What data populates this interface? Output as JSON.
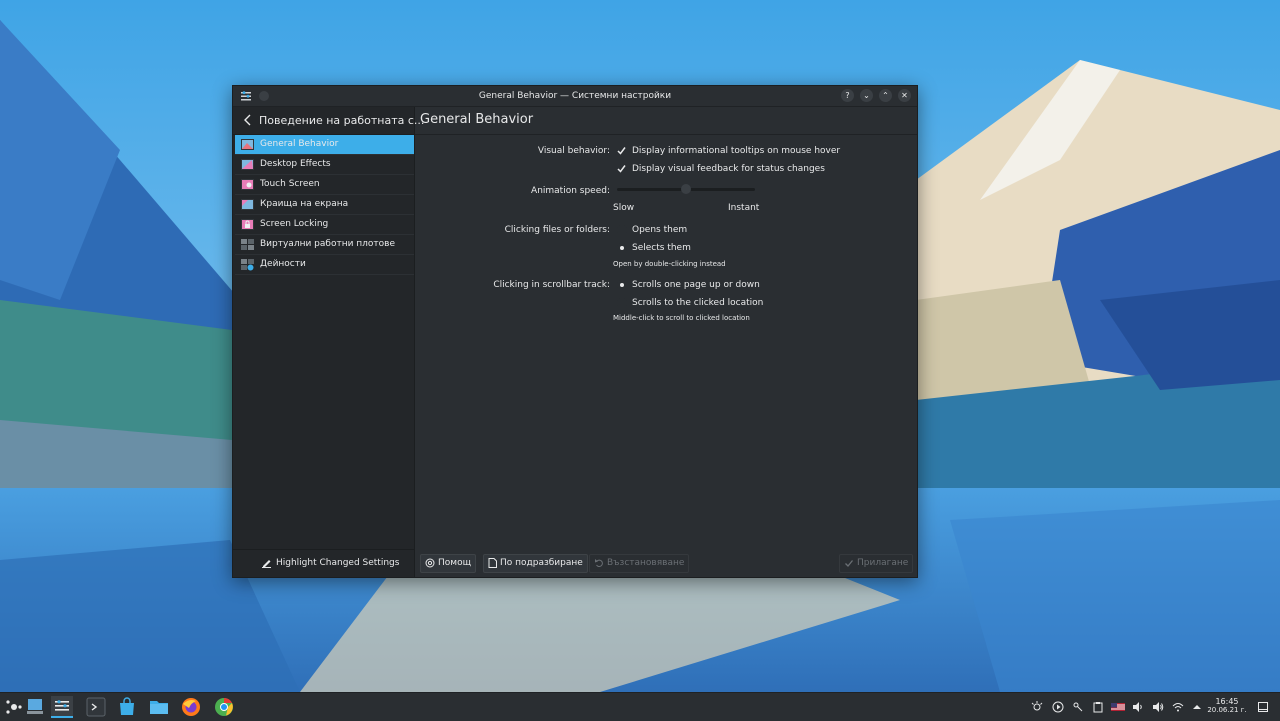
{
  "colors": {
    "accent": "#3daee9",
    "window_bg": "#2a2e32",
    "sidebar_bg": "#232629"
  },
  "window": {
    "title": "General Behavior — Системни настройки",
    "buttons": [
      "?",
      "⌄",
      "⌃",
      "✕"
    ]
  },
  "sidebar": {
    "back_icon": "arrow-left-icon",
    "title": "Поведение на работната с...",
    "items": [
      {
        "label": "General Behavior",
        "icon": "general-behavior-icon",
        "active": true
      },
      {
        "label": "Desktop Effects",
        "icon": "desktop-effects-icon"
      },
      {
        "label": "Touch Screen",
        "icon": "touch-screen-icon"
      },
      {
        "label": "Краища на екрана",
        "icon": "screen-edges-icon"
      },
      {
        "label": "Screen Locking",
        "icon": "screen-locking-icon"
      },
      {
        "label": "Виртуални работни плотове",
        "icon": "virtual-desktops-icon"
      },
      {
        "label": "Дейности",
        "icon": "activities-icon"
      }
    ],
    "footer_button": "Highlight Changed Settings"
  },
  "content": {
    "title": "General Behavior",
    "visual_behavior": {
      "label": "Visual behavior:",
      "options": [
        {
          "label": "Display informational tooltips on mouse hover",
          "checked": true
        },
        {
          "label": "Display visual feedback for status changes",
          "checked": true
        }
      ]
    },
    "animation_speed": {
      "label": "Animation speed:",
      "min_label": "Slow",
      "max_label": "Instant",
      "value_fraction": 0.5
    },
    "clicking_files": {
      "label": "Clicking files or folders:",
      "options": [
        {
          "label": "Opens them",
          "selected": false
        },
        {
          "label": "Selects them",
          "selected": true
        }
      ],
      "hint": "Open by double-clicking instead"
    },
    "scrollbar": {
      "label": "Clicking in scrollbar track:",
      "options": [
        {
          "label": "Scrolls one page up or down",
          "selected": true
        },
        {
          "label": "Scrolls to the clicked location",
          "selected": false
        }
      ],
      "hint": "Middle-click to scroll to clicked location"
    }
  },
  "buttons": {
    "help": "Помощ",
    "defaults": "По подразбиране",
    "reset": "Възстановяване",
    "apply": "Прилагане"
  },
  "taskbar": {
    "clock_time": "16:45",
    "clock_date": "20.06.21 г."
  }
}
